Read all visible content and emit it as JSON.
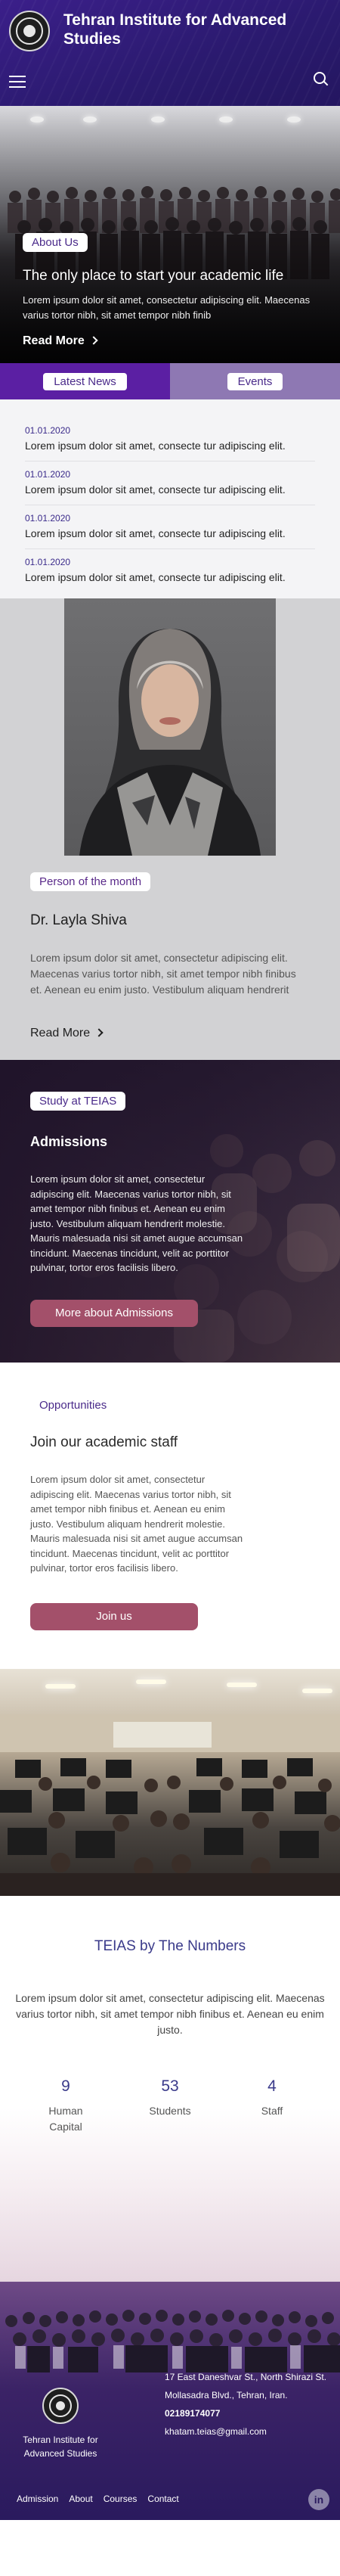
{
  "header": {
    "title": "Tehran Institute for Advanced Studies",
    "menu_icon": "hamburger-menu-icon",
    "search_icon": "search-icon"
  },
  "about": {
    "tag": "About Us",
    "heading": "The only place to start your academic life",
    "text": "Lorem ipsum dolor sit amet, consectetur adipiscing elit. Maecenas varius tortor nibh, sit amet tempor nibh finib",
    "read_more": "Read More"
  },
  "tabs": [
    {
      "label": "Latest News",
      "active": true
    },
    {
      "label": "Events",
      "active": false
    }
  ],
  "news": [
    {
      "date": "01.01.2020",
      "title": "Lorem ipsum dolor sit amet, consecte tur adipiscing elit."
    },
    {
      "date": "01.01.2020",
      "title": "Lorem ipsum dolor sit amet, consecte tur adipiscing elit."
    },
    {
      "date": "01.01.2020",
      "title": "Lorem ipsum dolor sit amet, consecte tur adipiscing elit."
    },
    {
      "date": "01.01.2020",
      "title": "Lorem ipsum dolor sit amet, consecte tur adipiscing elit."
    }
  ],
  "person": {
    "tag": "Person of the month",
    "name": "Dr. Layla Shiva",
    "text": "Lorem ipsum dolor sit amet, consectetur adipiscing elit. Maecenas varius tortor nibh, sit amet tempor nibh finibus et. Aenean eu enim justo. Vestibulum aliquam hendrerit",
    "read_more": "Read More"
  },
  "admissions": {
    "tag": "Study at TEIAS",
    "title": "Admissions",
    "text": "Lorem ipsum dolor sit amet, consectetur adipiscing elit. Maecenas varius tortor nibh, sit amet tempor nibh finibus et. Aenean eu enim justo. Vestibulum aliquam hendrerit molestie. Mauris malesuada nisi sit amet augue accumsan tincidunt. Maecenas tincidunt, velit ac porttitor pulvinar, tortor eros facilisis libero.",
    "button": "More about Admissions"
  },
  "opportunities": {
    "tag": "Opportunities",
    "title": "Join our academic staff",
    "text": "Lorem ipsum dolor sit amet, consectetur adipiscing elit. Maecenas varius tortor nibh, sit amet tempor nibh finibus et. Aenean eu enim justo. Vestibulum aliquam hendrerit molestie. Mauris malesuada nisi sit amet augue accumsan tincidunt. Maecenas tincidunt, velit ac porttitor pulvinar, tortor eros facilisis libero.",
    "button": "Join us"
  },
  "numbers": {
    "title": "TEIAS by The Numbers",
    "text": "Lorem ipsum dolor sit amet, consectetur adipiscing elit. Maecenas varius tortor nibh, sit amet tempor nibh finibus et. Aenean eu enim justo.",
    "stats": [
      {
        "value": "9",
        "label": "Human Capital"
      },
      {
        "value": "53",
        "label": "Students"
      },
      {
        "value": "4",
        "label": "Staff"
      }
    ]
  },
  "footer": {
    "name": "Tehran Institute for Advanced Studies",
    "address_line1": "17 East Daneshvar St., North Shirazi St.",
    "address_line2": "Mollasadra Blvd., Tehran, Iran.",
    "phone": "02189174077",
    "email": "khatam.teias@gmail.com",
    "nav": [
      "Admission",
      "About",
      "Courses",
      "Contact"
    ],
    "social_icon": "linkedin-icon",
    "social_label": "in"
  },
  "colors": {
    "brand_purple": "#5b1fa3",
    "header_purple": "#3b1f8a",
    "accent_rose": "#a3506a",
    "heading_blue": "#3a3a8a"
  }
}
